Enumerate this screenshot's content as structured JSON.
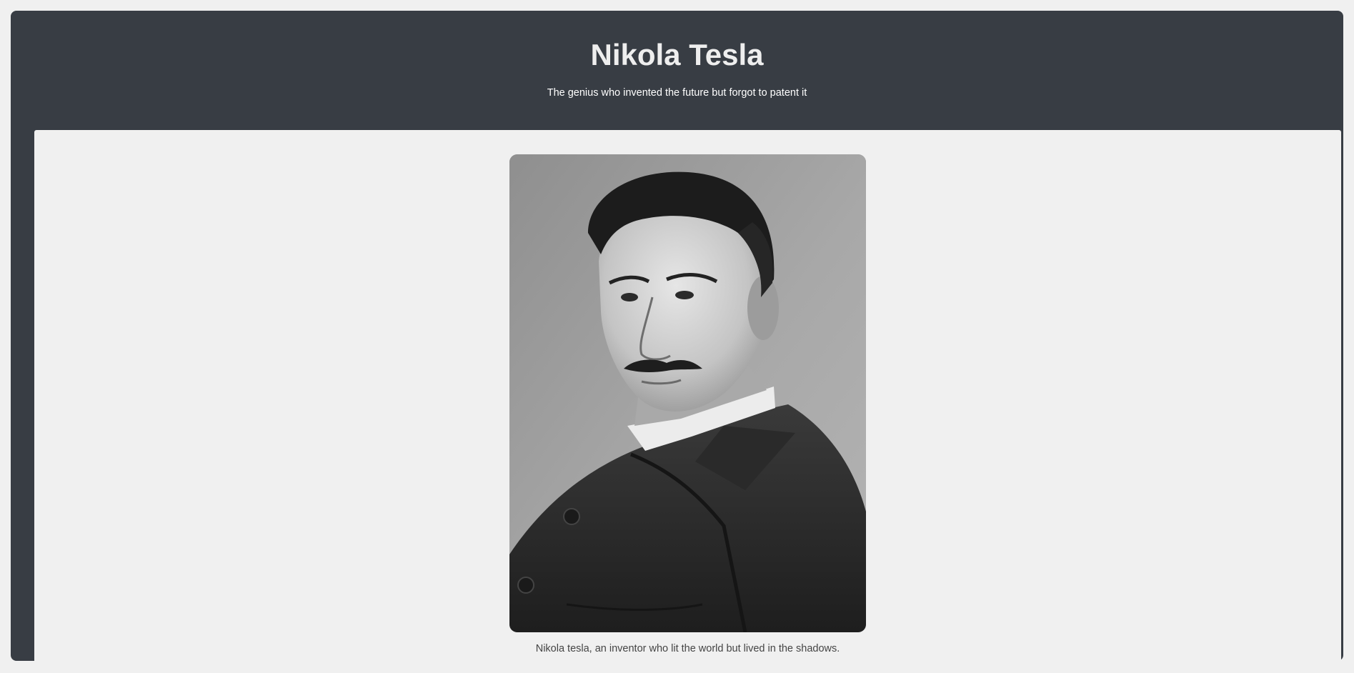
{
  "header": {
    "title": "Nikola Tesla",
    "subtitle": "The genius who invented the future but forgot to patent it"
  },
  "main": {
    "image_alt": "Nikola tesla portrait",
    "caption": "Nikola tesla, an inventor who lit the world but lived in the shadows."
  },
  "colors": {
    "header_bg": "#383d44",
    "content_bg": "#f0f0f0",
    "title_text": "#eeeeee",
    "caption_text": "#444444"
  }
}
